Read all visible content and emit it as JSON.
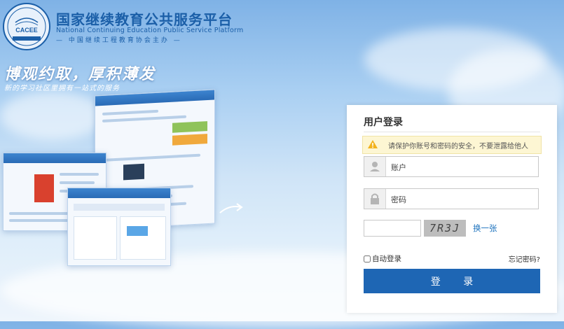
{
  "header": {
    "logo_text": "CACEE",
    "title": "国家继续教育公共服务平台",
    "subtitle_en": "National Continuing Education Public Service Platform",
    "organizer": "— 中国继续工程教育协会主办 —"
  },
  "hero": {
    "slogan": "博观约取，厚积薄发",
    "tagline": "新的学习社区里拥有一站式的服务"
  },
  "login": {
    "title": "用户登录",
    "notice": "请保护你账号和密码的安全，不要泄露给他人",
    "account_placeholder": "账户",
    "password_placeholder": "密码",
    "captcha_text": "7R3J",
    "refresh_label": "换一张",
    "auto_login_label": "自动登录",
    "forgot_label": "忘记密码?",
    "submit_label": "登 录"
  },
  "colors": {
    "brand": "#1b5fa8",
    "button": "#1e66b4",
    "link": "#1e73be"
  },
  "icons": [
    "warning-icon",
    "user-icon",
    "lock-icon",
    "arrow-right-icon"
  ]
}
